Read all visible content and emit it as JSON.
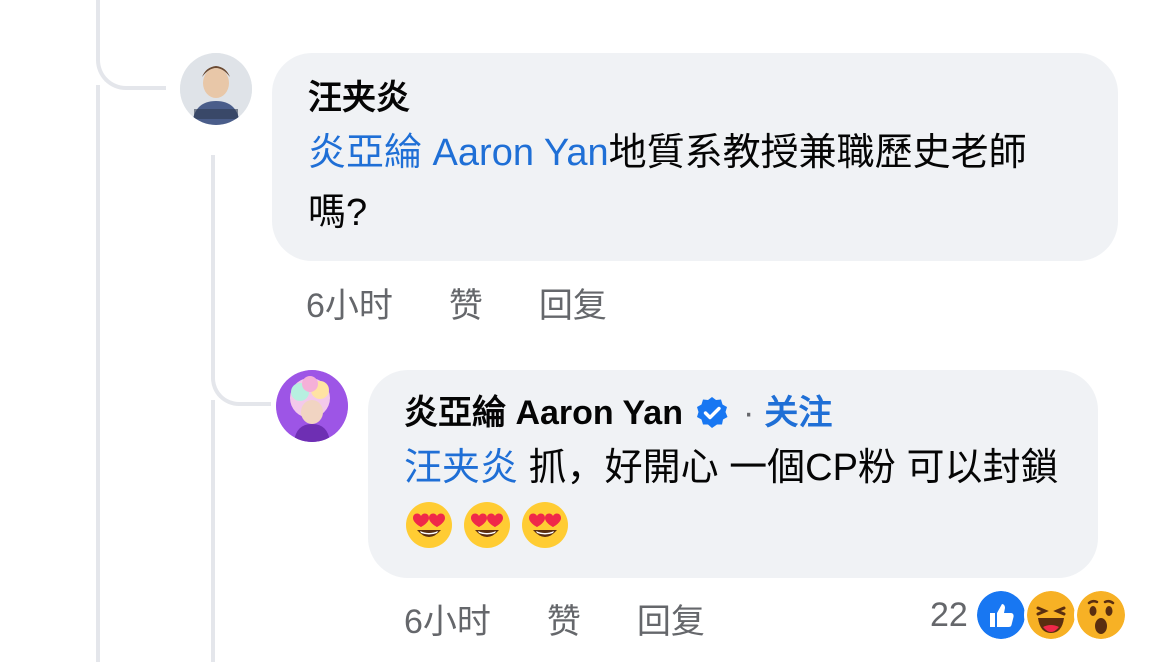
{
  "comment_1": {
    "author": "汪夹炎",
    "mention": "炎亞綸 Aaron Yan",
    "text": "地質系教授兼職歷史老師嗎?",
    "time": "6小时",
    "like_label": "赞",
    "reply_label": "回复"
  },
  "comment_2": {
    "author": "炎亞綸 Aaron Yan",
    "separator": "·",
    "follow_label": "关注",
    "mention": "汪夹炎",
    "text": " 抓，好開心 一個CP粉 可以封鎖",
    "emojis": [
      "heart-eyes-emoji",
      "heart-eyes-emoji",
      "heart-eyes-emoji"
    ],
    "time": "6小时",
    "like_label": "赞",
    "reply_label": "回复",
    "reaction_count": "22",
    "reactions": [
      "like-reaction-icon",
      "haha-reaction-icon",
      "wow-reaction-icon"
    ]
  },
  "colors": {
    "bubble": "#f0f2f5",
    "link": "#1f6fd6",
    "meta": "#65676b",
    "line": "#e4e6eb"
  }
}
